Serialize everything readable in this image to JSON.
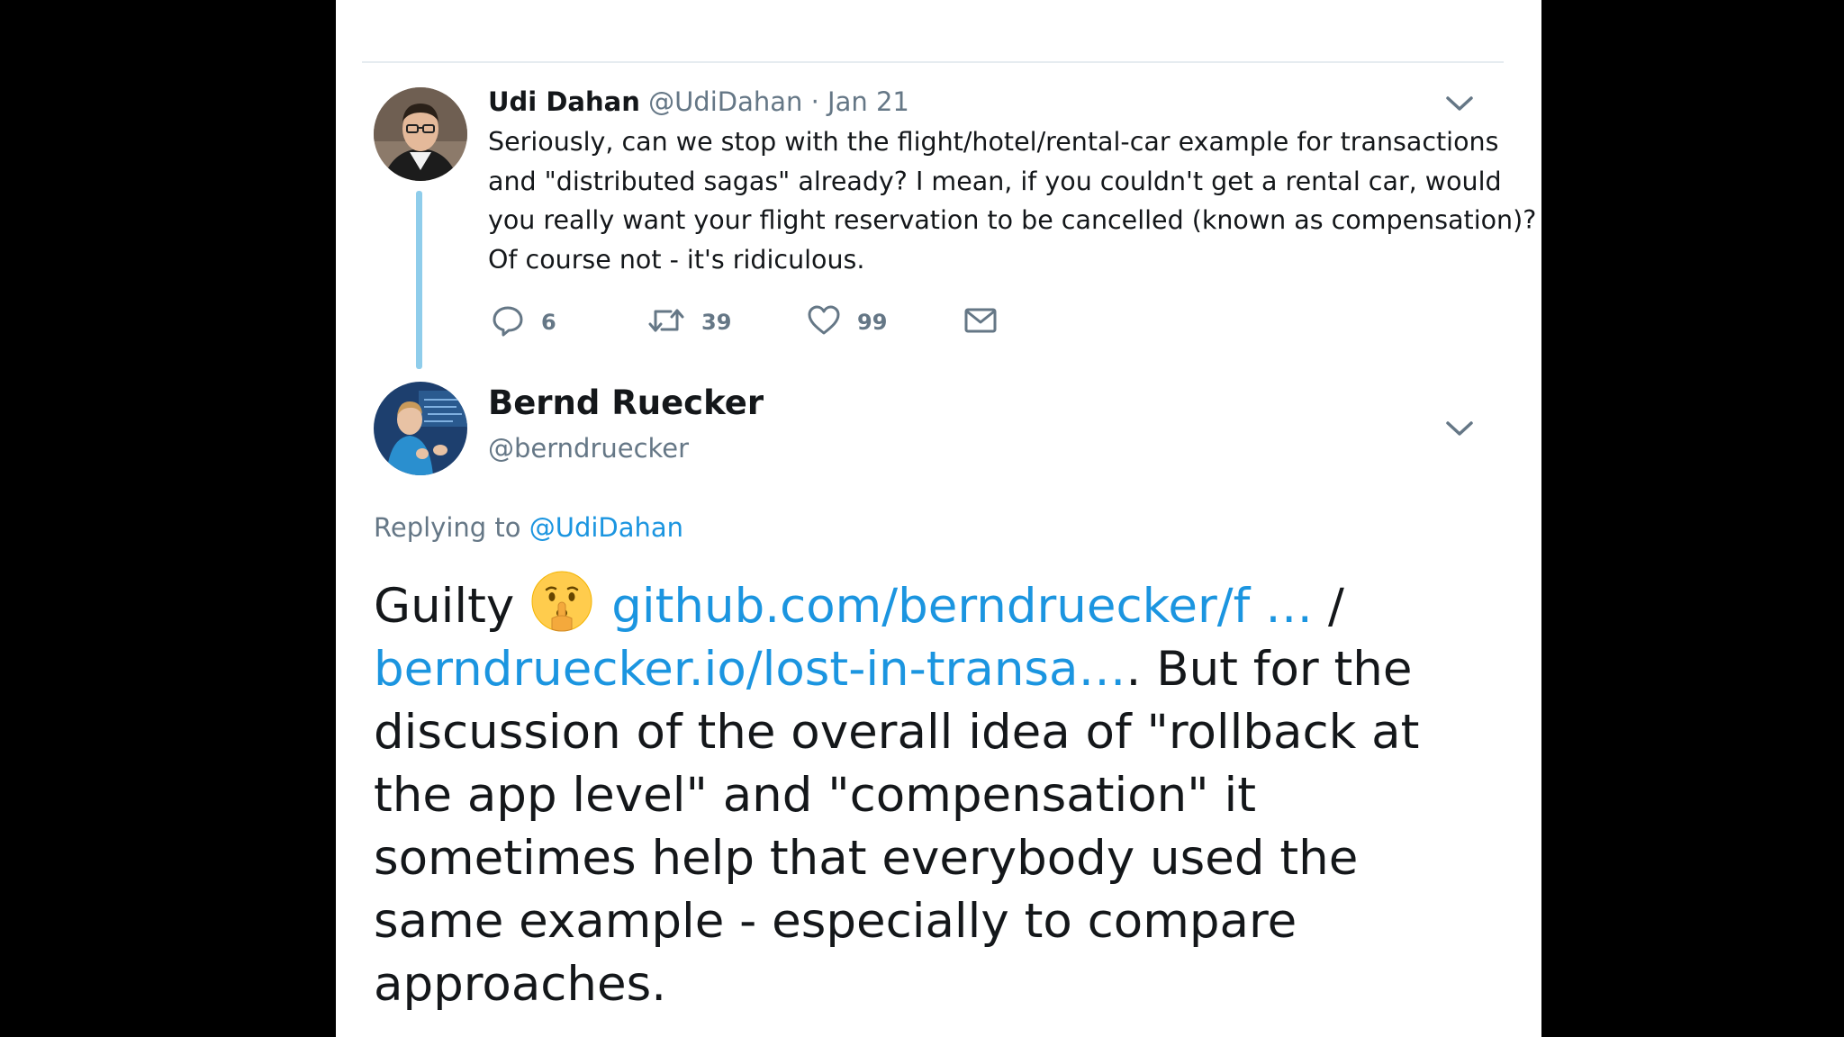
{
  "tweet1": {
    "name": "Udi Dahan",
    "handle": "@UdiDahan",
    "date": "· Jan 21",
    "text_lines": [
      "Seriously, can we stop with the flight/hotel/rental-car example for transactions",
      "and \"distributed sagas\" already? I mean, if you couldn't get a rental car, would",
      "you really want your flight reservation to be cancelled (known as compensation)?",
      "Of course not - it's ridiculous."
    ],
    "actions": {
      "replies": "6",
      "retweets": "39",
      "likes": "99"
    },
    "icons": [
      "reply-icon",
      "retweet-icon",
      "like-icon",
      "direct-message-icon",
      "chevron-down-icon"
    ]
  },
  "tweet2": {
    "name": "Bernd Ruecker",
    "handle": "@berndruecker",
    "replying_prefix": "Replying to",
    "replying_to": "@UdiDahan",
    "body": {
      "word_guilty": "Guilty",
      "emoji": "shushing-face-emoji",
      "link1": "github.com/berndruecker/f …",
      "slash": " /",
      "link2": "berndruecker.io/lost-in-transa…",
      "after_link2": ". But for the",
      "lines": [
        "discussion of the overall idea of \"rollback at",
        "the app level\" and \"compensation\" it",
        "sometimes help that everybody used the",
        "same example - especially to compare",
        "approaches."
      ]
    }
  },
  "colors": {
    "background": "#000000",
    "panel": "#ffffff",
    "text": "#14171a",
    "muted": "#657786",
    "link": "#1b95e0",
    "thread_line": "#8fcdeb"
  }
}
